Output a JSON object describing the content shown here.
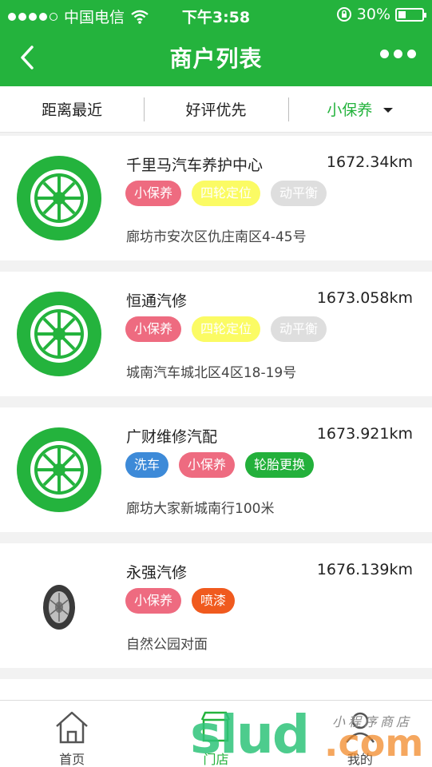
{
  "status_bar": {
    "carrier": "中国电信",
    "time": "下午3:58",
    "battery": "30%"
  },
  "nav": {
    "title": "商户列表"
  },
  "filters": [
    {
      "label": "距离最近"
    },
    {
      "label": "好评优先"
    },
    {
      "label": "小保养"
    }
  ],
  "colors": {
    "brand_green": "#24b33d",
    "tag_pink": "#ee6b80",
    "tag_yellow": "#fbfb64",
    "tag_gray": "#dedede",
    "tag_blue": "#3d8ad8",
    "tag_green": "#23b03b",
    "tag_orange": "#f05a1e"
  },
  "merchants": [
    {
      "name": "千里马汽车养护中心",
      "distance": "1672.34km",
      "tags": [
        "小保养",
        "四轮定位",
        "动平衡"
      ],
      "address": "廊坊市安次区仇庄南区4-45号",
      "thumb_icon": "wheel-logo-icon"
    },
    {
      "name": "恒通汽修",
      "distance": "1673.058km",
      "tags": [
        "小保养",
        "四轮定位",
        "动平衡"
      ],
      "address": "城南汽车城北区4区18-19号",
      "thumb_icon": "wheel-logo-icon"
    },
    {
      "name": "广财维修汽配",
      "distance": "1673.921km",
      "tags": [
        "洗车",
        "小保养",
        "轮胎更换"
      ],
      "address": "廊坊大家新城南行100米",
      "thumb_icon": "wheel-logo-icon"
    },
    {
      "name": "永强汽修",
      "distance": "1676.139km",
      "tags": [
        "小保养",
        "喷漆"
      ],
      "address": "自然公园对面",
      "thumb_icon": "tire-photo-icon"
    }
  ],
  "tabbar": [
    {
      "label": "首页",
      "icon": "home-icon"
    },
    {
      "label": "门店",
      "icon": "store-icon"
    },
    {
      "label": "我的",
      "icon": "person-icon"
    }
  ],
  "watermark": {
    "main": "slud",
    "suffix": ".com",
    "sub": "小程序商店"
  }
}
